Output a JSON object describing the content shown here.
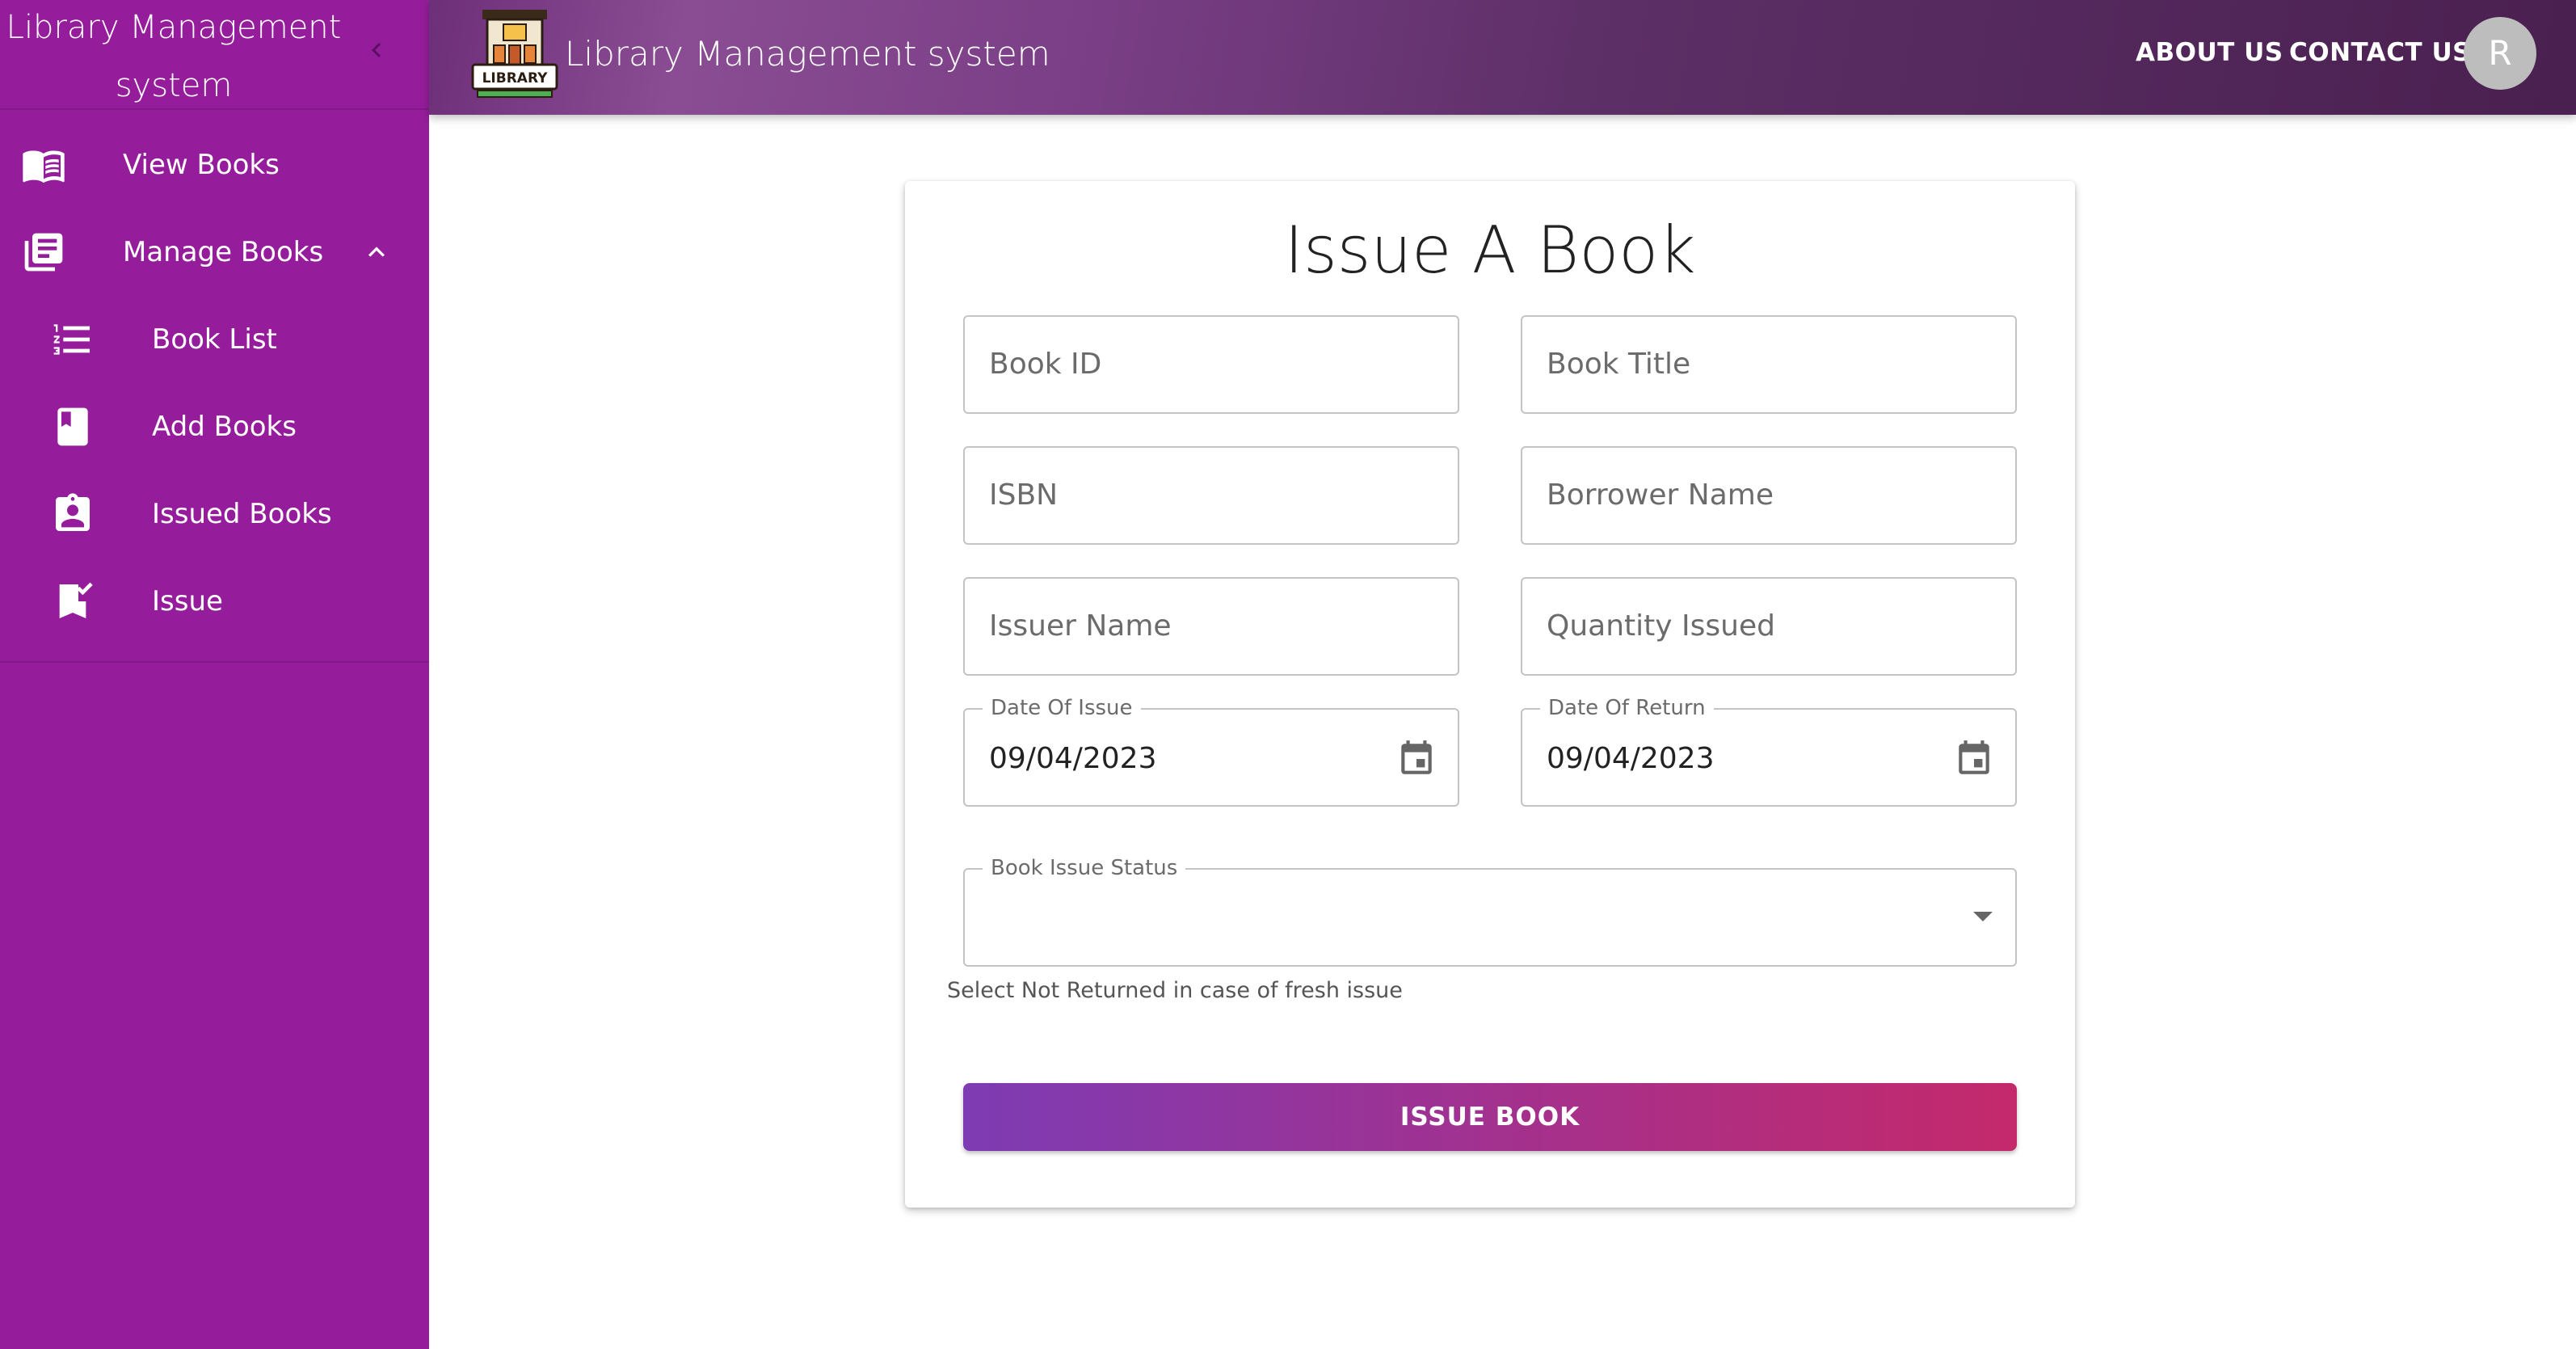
{
  "sidebar": {
    "title": "Library Management system",
    "items": [
      {
        "label": "View Books",
        "icon": "open-book-icon"
      },
      {
        "label": "Manage Books",
        "icon": "library-books-icon"
      },
      {
        "label": "Book List",
        "icon": "list-icon"
      },
      {
        "label": "Add Books",
        "icon": "book-icon"
      },
      {
        "label": "Issued Books",
        "icon": "assignment-ind-icon"
      },
      {
        "label": "Issue",
        "icon": "bookmark-check-icon"
      }
    ]
  },
  "appbar": {
    "logo_text": "LIBRARY",
    "title": "Library Management system",
    "about": "ABOUT US",
    "contact": "CONTACT US",
    "avatar_letter": "R"
  },
  "form": {
    "title": "Issue A Book",
    "book_id_placeholder": "Book ID",
    "book_title_placeholder": "Book Title",
    "isbn_placeholder": "ISBN",
    "borrower_placeholder": "Borrower Name",
    "issuer_placeholder": "Issuer Name",
    "quantity_placeholder": "Quantity Issued",
    "date_issue_label": "Date Of Issue",
    "date_issue_value": "09/04/2023",
    "date_return_label": "Date Of Return",
    "date_return_value": "09/04/2023",
    "status_label": "Book Issue Status",
    "status_value": "",
    "status_helper": "Select Not Returned in case of fresh issue",
    "submit_label": "ISSUE BOOK"
  },
  "colors": {
    "sidebar_bg": "#951d9b",
    "appbar_gradient": [
      "#8a4d93",
      "#4a2050"
    ],
    "button_gradient": [
      "#7e3bb3",
      "#c4296b"
    ]
  }
}
